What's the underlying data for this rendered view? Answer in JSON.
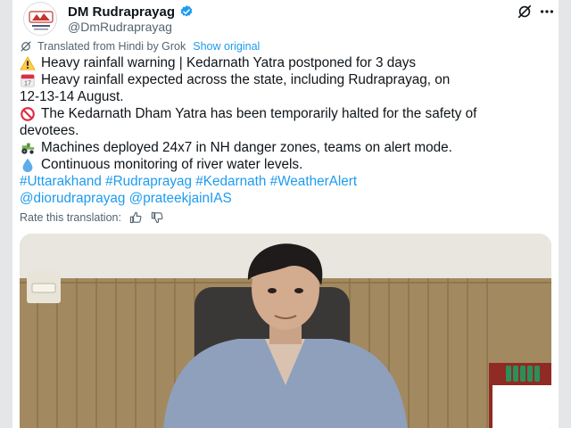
{
  "tweet": {
    "display_name": "DM Rudraprayag",
    "handle": "@DmRudraprayag",
    "translated_from": "Translated from Hindi by Grok",
    "show_original": "Show original",
    "lines": [
      {
        "icon": "warning-icon",
        "text": "Heavy rainfall warning | Kedarnath Yatra postponed for 3 days"
      },
      {
        "icon": "calendar-icon",
        "text": "Heavy rainfall expected across the state, including Rudraprayag, on"
      },
      {
        "icon": "",
        "text": "12-13-14 August."
      },
      {
        "icon": "prohibited-icon",
        "text": "The Kedarnath Dham Yatra has been temporarily halted for the safety of"
      },
      {
        "icon": "",
        "text": "devotees."
      },
      {
        "icon": "tractor-icon",
        "text": "Machines deployed 24x7 in NH danger zones, teams on alert mode."
      },
      {
        "icon": "droplet-icon",
        "text": "Continuous monitoring of river water levels."
      }
    ],
    "hashtags_line1": "#Uttarakhand #Rudraprayag #Kedarnath #WeatherAlert",
    "hashtags_line2": "@diorudraprayag @prateekjainIAS",
    "rate_label": "Rate this translation:",
    "calendar_day": "17"
  },
  "colors": {
    "link": "#1d9bf0",
    "text": "#0f1419",
    "muted": "#536471",
    "verified": "#1d9bf0"
  }
}
